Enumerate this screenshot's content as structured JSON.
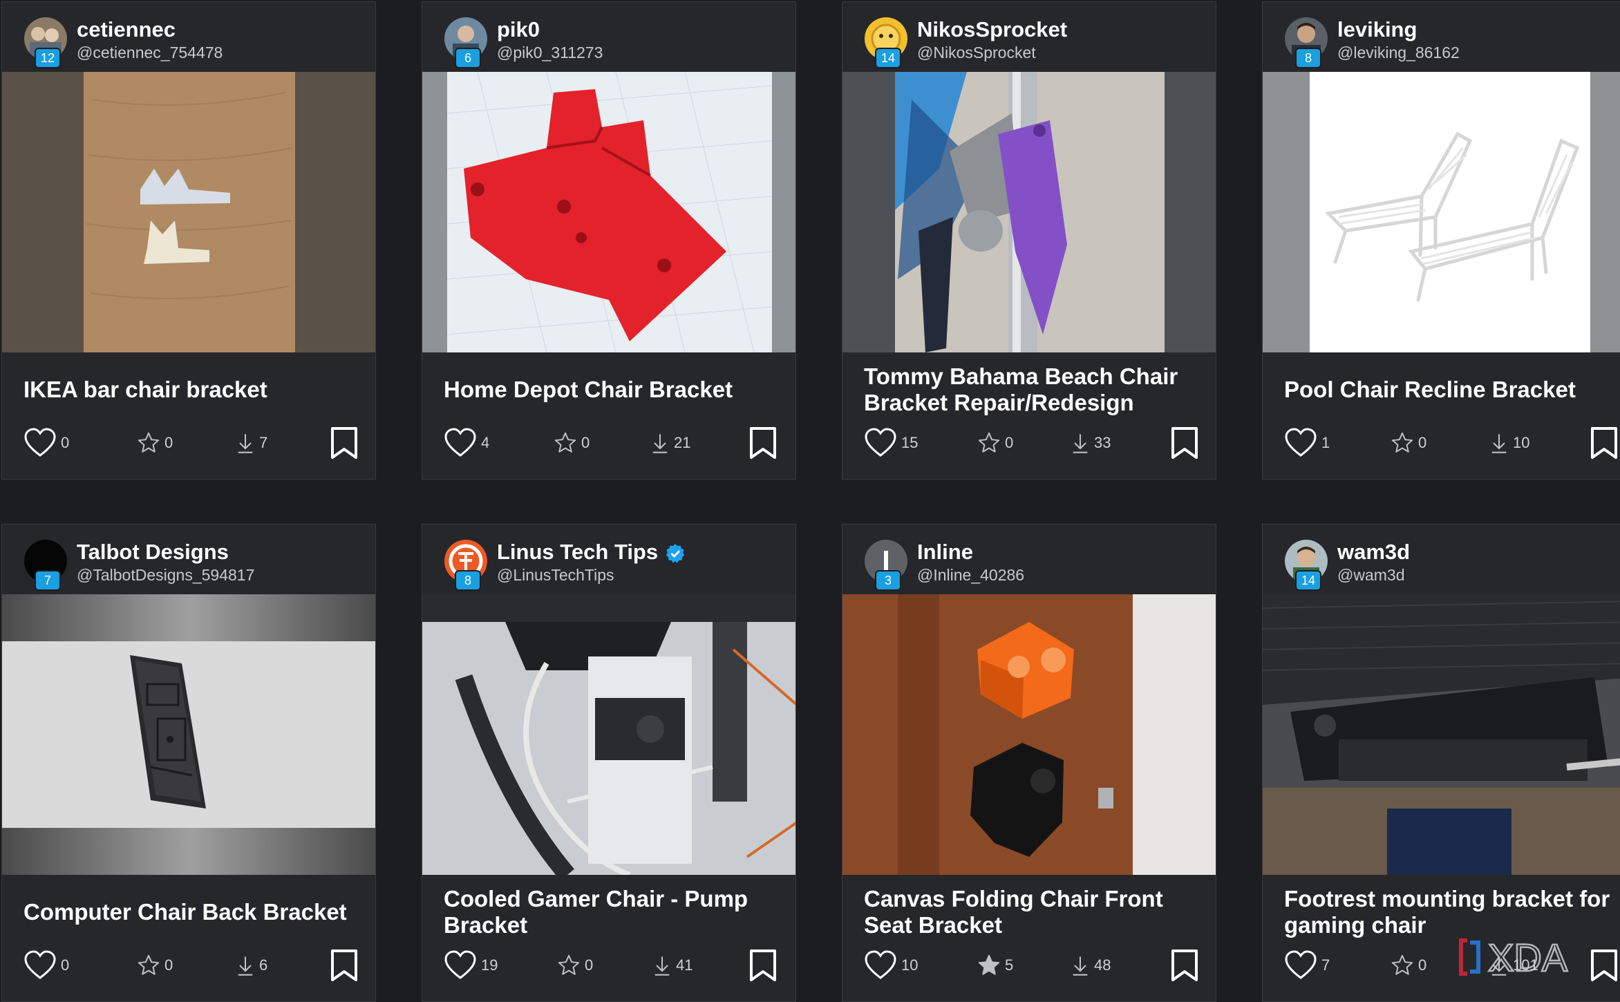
{
  "cards": [
    {
      "name": "cetiennec",
      "handle": "@cetiennec_754478",
      "level": "12",
      "title": "IKEA bar chair bracket",
      "likes": "0",
      "stars": "0",
      "downloads": "7",
      "star_filled": false,
      "verified": false
    },
    {
      "name": "pik0",
      "handle": "@pik0_311273",
      "level": "6",
      "title": "Home Depot Chair Bracket",
      "likes": "4",
      "stars": "0",
      "downloads": "21",
      "star_filled": false,
      "verified": false
    },
    {
      "name": "NikosSprocket",
      "handle": "@NikosSprocket",
      "level": "14",
      "title": "Tommy Bahama Beach Chair Bracket Repair/Redesign",
      "likes": "15",
      "stars": "0",
      "downloads": "33",
      "star_filled": false,
      "verified": false
    },
    {
      "name": "leviking",
      "handle": "@leviking_86162",
      "level": "8",
      "title": "Pool Chair Recline Bracket",
      "likes": "1",
      "stars": "0",
      "downloads": "10",
      "star_filled": false,
      "verified": false
    },
    {
      "name": "Talbot Designs",
      "handle": "@TalbotDesigns_594817",
      "level": "7",
      "title": "Computer Chair Back Bracket",
      "likes": "0",
      "stars": "0",
      "downloads": "6",
      "star_filled": false,
      "verified": false
    },
    {
      "name": "Linus Tech Tips",
      "handle": "@LinusTechTips",
      "level": "8",
      "title": "Cooled Gamer Chair - Pump Bracket",
      "likes": "19",
      "stars": "0",
      "downloads": "41",
      "star_filled": false,
      "verified": true
    },
    {
      "name": "Inline",
      "handle": "@Inline_40286",
      "level": "3",
      "title": "Canvas Folding Chair Front Seat Bracket",
      "likes": "10",
      "stars": "5",
      "downloads": "48",
      "star_filled": true,
      "verified": false
    },
    {
      "name": "wam3d",
      "handle": "@wam3d",
      "level": "14",
      "title": "Footrest mounting bracket for gaming chair",
      "likes": "7",
      "stars": "0",
      "downloads": "101",
      "star_filled": false,
      "verified": false
    }
  ],
  "icons": {
    "like": "heart-icon",
    "star": "star-icon",
    "download": "download-icon",
    "bookmark": "bookmark-icon",
    "verified": "verified-check-icon"
  },
  "colors": {
    "background": "#1c1d20",
    "card": "#26272b",
    "level_badge": "#1a9fe0",
    "verified": "#1da1f2"
  },
  "watermark": "XDA"
}
